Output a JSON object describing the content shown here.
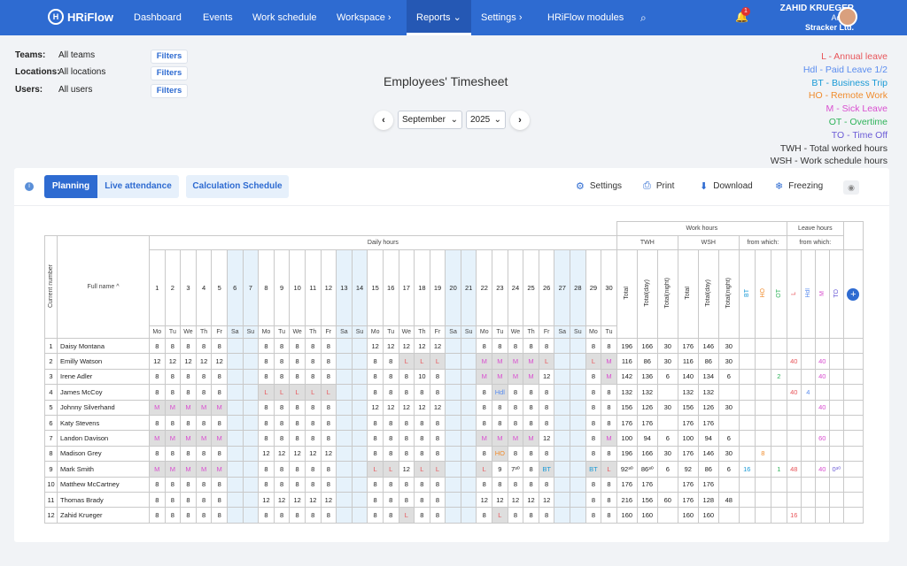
{
  "nav": {
    "logo": "HRiFlow",
    "items": [
      "Dashboard",
      "Events",
      "Work schedule",
      "Workspace",
      "Reports",
      "Settings",
      "HRiFlow modules"
    ],
    "active": "Reports",
    "notifications": "1",
    "user_name": "ZAHID KRUEGER",
    "user_role": "Admin",
    "user_company": "Stracker Ltd."
  },
  "filters": {
    "teams_label": "Teams:",
    "teams_value": "All teams",
    "locations_label": "Locations:",
    "locations_value": "All locations",
    "users_label": "Users:",
    "users_value": "All users",
    "button_label": "Filters"
  },
  "title": "Employees' Timesheet",
  "month": "September",
  "year": "2025",
  "legend": [
    {
      "text": "L - Annual leave",
      "color": "#e8555a"
    },
    {
      "text": "Hdl - Paid Leave 1/2",
      "color": "#5b8def"
    },
    {
      "text": "BT - Business Trip",
      "color": "#1a9ad6"
    },
    {
      "text": "HO - Remote Work",
      "color": "#f08c2e"
    },
    {
      "text": "M - Sick Leave",
      "color": "#d94fd0"
    },
    {
      "text": "OT - Overtime",
      "color": "#2fb35a"
    },
    {
      "text": "TO - Time Off",
      "color": "#6b5bd6"
    },
    {
      "text": "TWH - Total worked hours",
      "color": "#333333"
    },
    {
      "text": "WSH - Work schedule hours",
      "color": "#333333"
    }
  ],
  "toolbar": {
    "planning": "Planning",
    "live": "Live attendance",
    "calc": "Calculation Schedule",
    "settings": "Settings",
    "print": "Print",
    "download": "Download",
    "freezing": "Freezing"
  },
  "table": {
    "work_hours": "Work hours",
    "leave_hours": "Leave hours",
    "daily_hours": "Daily hours",
    "twh": "TWH",
    "wsh": "WSH",
    "from_which": "from which:",
    "current_number": "Current number",
    "full_name": "Full name",
    "days": [
      1,
      2,
      3,
      4,
      5,
      6,
      7,
      8,
      9,
      10,
      11,
      12,
      13,
      14,
      15,
      16,
      17,
      18,
      19,
      20,
      21,
      22,
      23,
      24,
      25,
      26,
      27,
      28,
      29,
      30
    ],
    "weekdays": [
      "Mo",
      "Tu",
      "We",
      "Th",
      "Fr",
      "Sa",
      "Su",
      "Mo",
      "Tu",
      "We",
      "Th",
      "Fr",
      "Sa",
      "Su",
      "Mo",
      "Tu",
      "We",
      "Th",
      "Fr",
      "Sa",
      "Su",
      "Mo",
      "Tu",
      "We",
      "Th",
      "Fr",
      "Sa",
      "Su",
      "Mo",
      "Tu"
    ],
    "weekend_cols": [
      6,
      7,
      13,
      14,
      20,
      21,
      27,
      28
    ],
    "summary_headers": [
      "Total",
      "Total(day)",
      "Total(night)",
      "Total",
      "Total(day)",
      "Total(night)",
      "BT",
      "HO",
      "OT",
      "L",
      "Hdl",
      "M",
      "TO"
    ],
    "rows": [
      {
        "n": 1,
        "name": "Daisy Montana",
        "d": [
          "8",
          "8",
          "8",
          "8",
          "8",
          "",
          "",
          "8",
          "8",
          "8",
          "8",
          "8",
          "",
          "",
          "12",
          "12",
          "12",
          "12",
          "12",
          "",
          "",
          "8",
          "8",
          "8",
          "8",
          "8",
          "",
          "",
          "8",
          "8"
        ],
        "s": [
          "196",
          "166",
          "30",
          "176",
          "146",
          "30",
          "",
          "",
          "",
          "",
          "",
          "",
          ""
        ]
      },
      {
        "n": 2,
        "name": "Emilly Watson",
        "d": [
          "12",
          "12",
          "12",
          "12",
          "12",
          "",
          "",
          "8",
          "8",
          "8",
          "8",
          "8",
          "",
          "",
          "8",
          "8",
          "L",
          "L",
          "L",
          "",
          "",
          "M",
          "M",
          "M",
          "M",
          "L",
          "",
          "",
          "L",
          "M"
        ],
        "s": [
          "116",
          "86",
          "30",
          "116",
          "86",
          "30",
          "",
          "",
          "",
          "40",
          "",
          "40",
          ""
        ]
      },
      {
        "n": 3,
        "name": "Irene Adler",
        "d": [
          "8",
          "8",
          "8",
          "8",
          "8",
          "",
          "",
          "8",
          "8",
          "8",
          "8",
          "8",
          "",
          "",
          "8",
          "8",
          "8",
          "10",
          "8",
          "",
          "",
          "M",
          "M",
          "M",
          "M",
          "12",
          "",
          "",
          "8",
          "M"
        ],
        "s": [
          "142",
          "136",
          "6",
          "140",
          "134",
          "6",
          "",
          "",
          "2",
          "",
          "",
          "40",
          ""
        ]
      },
      {
        "n": 4,
        "name": "James McCoy",
        "d": [
          "8",
          "8",
          "8",
          "8",
          "8",
          "",
          "",
          "L",
          "L",
          "L",
          "L",
          "L",
          "",
          "",
          "8",
          "8",
          "8",
          "8",
          "8",
          "",
          "",
          "8",
          "Hdl",
          "8",
          "8",
          "8",
          "",
          "",
          "8",
          "8"
        ],
        "s": [
          "132",
          "132",
          "",
          "132",
          "132",
          "",
          "",
          "",
          "",
          "40",
          "4",
          "",
          ""
        ]
      },
      {
        "n": 5,
        "name": "Johnny Silverhand",
        "d": [
          "M",
          "M",
          "M",
          "M",
          "M",
          "",
          "",
          "8",
          "8",
          "8",
          "8",
          "8",
          "",
          "",
          "12",
          "12",
          "12",
          "12",
          "12",
          "",
          "",
          "8",
          "8",
          "8",
          "8",
          "8",
          "",
          "",
          "8",
          "8"
        ],
        "s": [
          "156",
          "126",
          "30",
          "156",
          "126",
          "30",
          "",
          "",
          "",
          "",
          "",
          "40",
          ""
        ]
      },
      {
        "n": 6,
        "name": "Katy Stevens",
        "d": [
          "8",
          "8",
          "8",
          "8",
          "8",
          "",
          "",
          "8",
          "8",
          "8",
          "8",
          "8",
          "",
          "",
          "8",
          "8",
          "8",
          "8",
          "8",
          "",
          "",
          "8",
          "8",
          "8",
          "8",
          "8",
          "",
          "",
          "8",
          "8"
        ],
        "s": [
          "176",
          "176",
          "",
          "176",
          "176",
          "",
          "",
          "",
          "",
          "",
          "",
          "",
          ""
        ]
      },
      {
        "n": 7,
        "name": "Landon Davison",
        "d": [
          "M",
          "M",
          "M",
          "M",
          "M",
          "",
          "",
          "8",
          "8",
          "8",
          "8",
          "8",
          "",
          "",
          "8",
          "8",
          "8",
          "8",
          "8",
          "",
          "",
          "M",
          "M",
          "M",
          "M",
          "12",
          "",
          "",
          "8",
          "M"
        ],
        "s": [
          "100",
          "94",
          "6",
          "100",
          "94",
          "6",
          "",
          "",
          "",
          "",
          "",
          "60",
          ""
        ]
      },
      {
        "n": 8,
        "name": "Madison Grey",
        "d": [
          "8",
          "8",
          "8",
          "8",
          "8",
          "",
          "",
          "12",
          "12",
          "12",
          "12",
          "12",
          "",
          "",
          "8",
          "8",
          "8",
          "8",
          "8",
          "",
          "",
          "8",
          "HO",
          "8",
          "8",
          "8",
          "",
          "",
          "8",
          "8"
        ],
        "s": [
          "196",
          "166",
          "30",
          "176",
          "146",
          "30",
          "",
          "8",
          "",
          "",
          "",
          "",
          ""
        ]
      },
      {
        "n": 9,
        "name": "Mark Smith",
        "d": [
          "M",
          "M",
          "M",
          "M",
          "M",
          "",
          "",
          "8",
          "8",
          "8",
          "8",
          "8",
          "",
          "",
          "L",
          "L",
          "12",
          "L",
          "L",
          "",
          "",
          "L",
          "9",
          "7³⁰",
          "8",
          "BT",
          "",
          "",
          "BT",
          "L"
        ],
        "s": [
          "92³⁰",
          "86³⁰",
          "6",
          "92",
          "86",
          "6",
          "16",
          "",
          "1",
          "48",
          "",
          "40",
          "0³⁰"
        ]
      },
      {
        "n": 10,
        "name": "Matthew McCartney",
        "d": [
          "8",
          "8",
          "8",
          "8",
          "8",
          "",
          "",
          "8",
          "8",
          "8",
          "8",
          "8",
          "",
          "",
          "8",
          "8",
          "8",
          "8",
          "8",
          "",
          "",
          "8",
          "8",
          "8",
          "8",
          "8",
          "",
          "",
          "8",
          "8"
        ],
        "s": [
          "176",
          "176",
          "",
          "176",
          "176",
          "",
          "",
          "",
          "",
          "",
          "",
          "",
          ""
        ]
      },
      {
        "n": 11,
        "name": "Thomas Brady",
        "d": [
          "8",
          "8",
          "8",
          "8",
          "8",
          "",
          "",
          "12",
          "12",
          "12",
          "12",
          "12",
          "",
          "",
          "8",
          "8",
          "8",
          "8",
          "8",
          "",
          "",
          "12",
          "12",
          "12",
          "12",
          "12",
          "",
          "",
          "8",
          "8"
        ],
        "s": [
          "216",
          "156",
          "60",
          "176",
          "128",
          "48",
          "",
          "",
          "",
          "",
          "",
          "",
          ""
        ]
      },
      {
        "n": 12,
        "name": "Zahid Krueger",
        "d": [
          "8",
          "8",
          "8",
          "8",
          "8",
          "",
          "",
          "8",
          "8",
          "8",
          "8",
          "8",
          "",
          "",
          "8",
          "8",
          "L",
          "8",
          "8",
          "",
          "",
          "8",
          "L",
          "8",
          "8",
          "8",
          "",
          "",
          "8",
          "8"
        ],
        "s": [
          "160",
          "160",
          "",
          "160",
          "160",
          "",
          "",
          "",
          "",
          "16",
          "",
          "",
          ""
        ]
      }
    ]
  }
}
